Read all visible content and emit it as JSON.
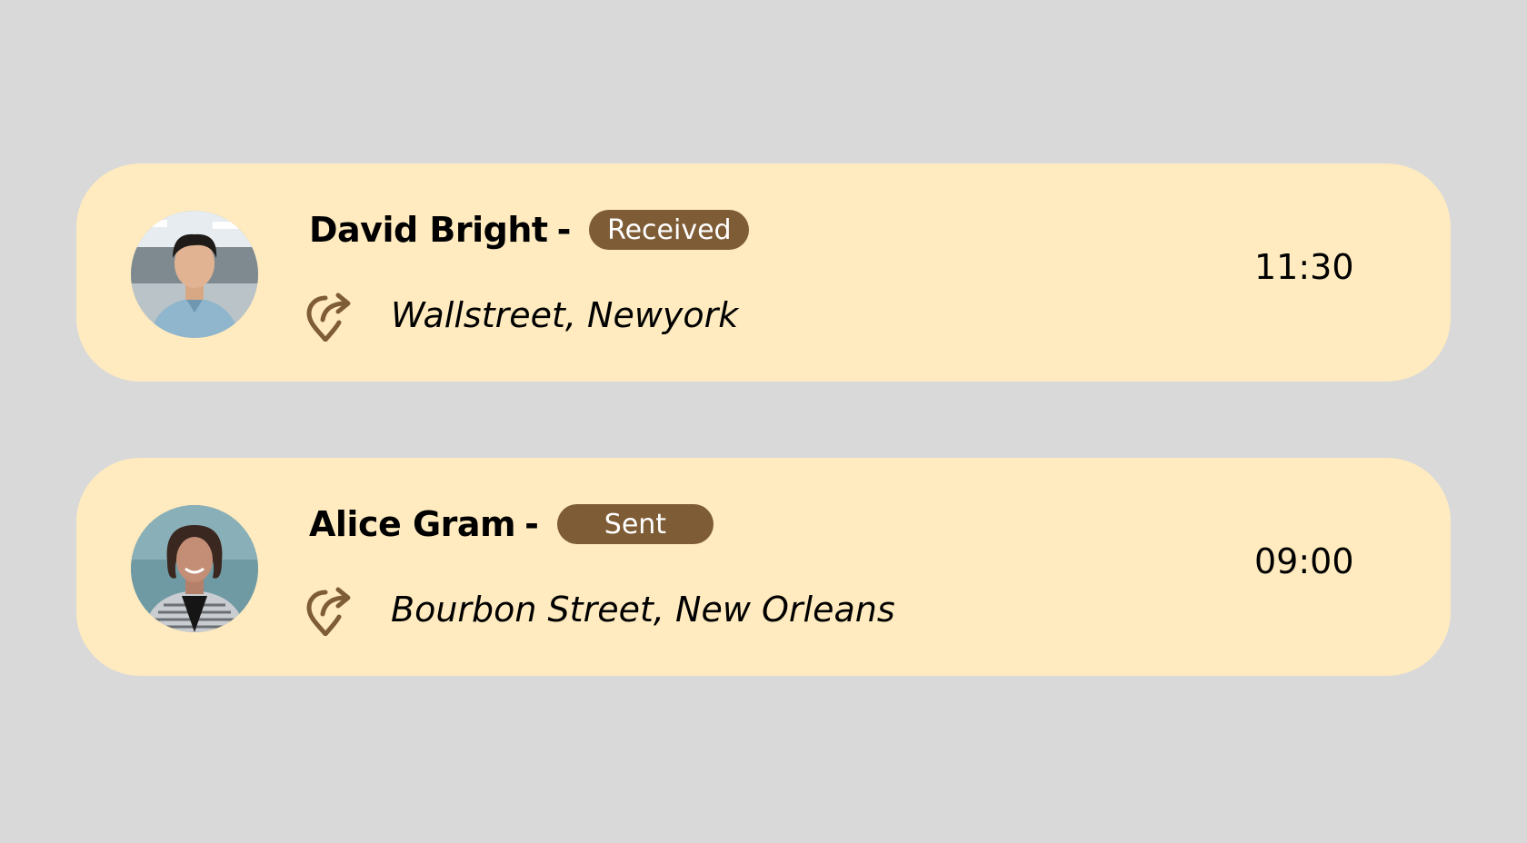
{
  "colors": {
    "page_background": "#d9d9d9",
    "card_background": "#ffebbf",
    "badge_background": "#7e5c36",
    "badge_text": "#ffffff",
    "icon": "#7e5c36"
  },
  "messages": [
    {
      "name": "David Bright",
      "separator": "-",
      "status": "Received",
      "location_icon": "location-share-icon",
      "address": "Wallstreet, Newyork",
      "time": "11:30"
    },
    {
      "name": "Alice Gram",
      "separator": "-",
      "status": "Sent",
      "location_icon": "location-share-icon",
      "address": "Bourbon Street, New Orleans",
      "time": "09:00"
    }
  ]
}
